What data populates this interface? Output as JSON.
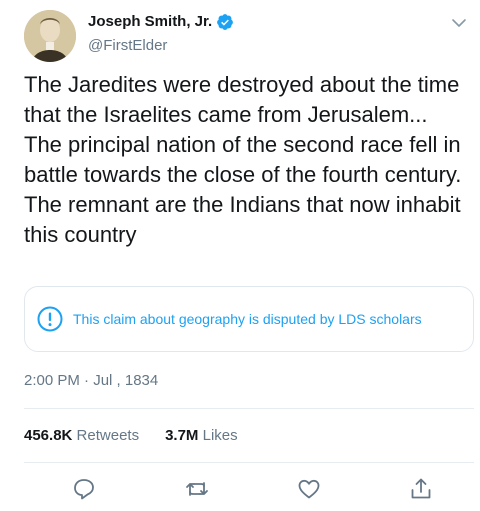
{
  "author": {
    "name": "Joseph Smith, Jr.",
    "handle": "@FirstElder",
    "verified": true
  },
  "tweet": {
    "text": "The Jaredites were destroyed about the time that the Israelites came from Jerusalem... The principal nation of the second race fell in battle towards the close of the fourth century. The remnant are the Indians that now inhabit this country",
    "notice": "This claim about geography is disputed by LDS scholars",
    "timestamp": "2:00 PM · Jul , 1834",
    "retweets_count": "456.8K",
    "retweets_label": "Retweets",
    "likes_count": "3.7M",
    "likes_label": "Likes"
  },
  "icons": {
    "reply": "reply-icon",
    "retweet": "retweet-icon",
    "like": "like-icon",
    "share": "share-icon",
    "caret": "chevron-down-icon",
    "verified": "verified-badge-icon",
    "notice": "info-icon"
  },
  "colors": {
    "accent": "#1da1f2",
    "text": "#14171a",
    "muted": "#657786"
  }
}
